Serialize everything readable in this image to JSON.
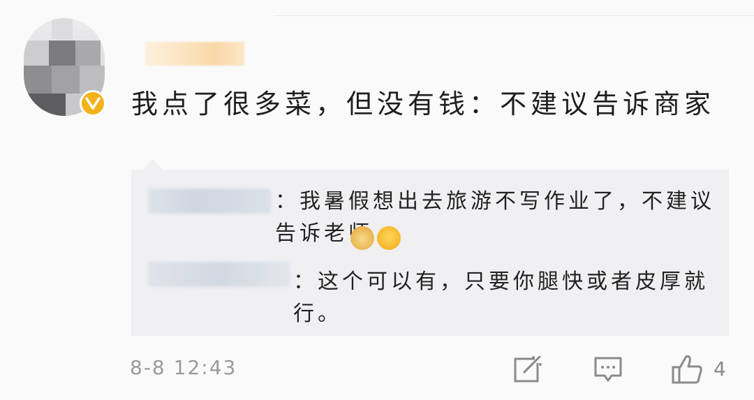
{
  "post": {
    "comment_text": "我点了很多菜，但没有钱：不建议告诉商家",
    "timestamp": "8-8 12:43",
    "like_count": "4"
  },
  "replies": [
    {
      "text": "：我暑假想出去旅游不写作业了，不建议告诉老师"
    },
    {
      "text": "：这个可以有，只要你腿快或者皮厚就行。"
    }
  ],
  "icons": {
    "verified": "verified-v-badge-icon",
    "repost": "repost-icon",
    "comment": "comment-icon",
    "like": "thumbs-up-icon"
  },
  "colors": {
    "verified_badge": "#f3b21b",
    "reply_bg": "#f0f0f3",
    "meta_text": "#9a9a9a"
  }
}
